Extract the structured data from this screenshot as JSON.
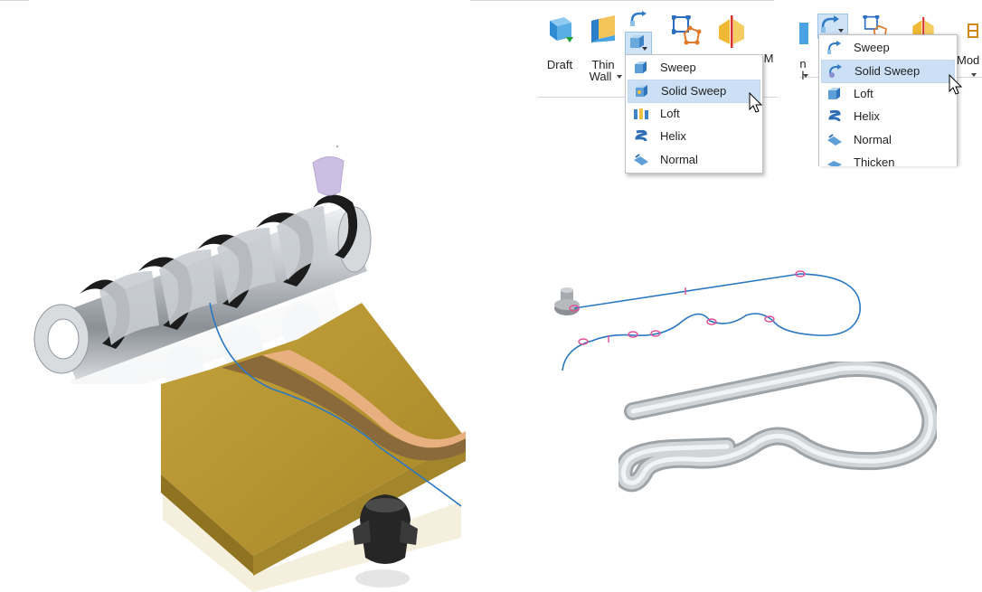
{
  "ribbon_left": {
    "draft_label": "Draft",
    "thin_wall_label": [
      "Thin",
      "Wall"
    ],
    "partial_label": "M",
    "menu_items": [
      {
        "label": "Sweep",
        "icon": "sweep-icon",
        "selected": false
      },
      {
        "label": "Solid Sweep",
        "icon": "solid-sweep-icon",
        "selected": true
      },
      {
        "label": "Loft",
        "icon": "loft-icon",
        "selected": false
      },
      {
        "label": "Helix",
        "icon": "helix-icon",
        "selected": false
      },
      {
        "label": "Normal",
        "icon": "normal-icon",
        "selected": false
      }
    ]
  },
  "ribbon_right": {
    "partial_left_label": [
      "n",
      "l"
    ],
    "partial_right_label": "Mod",
    "menu_items": [
      {
        "label": "Sweep",
        "icon": "sweep-icon",
        "selected": false
      },
      {
        "label": "Solid Sweep",
        "icon": "solid-sweep-icon",
        "selected": true
      },
      {
        "label": "Loft",
        "icon": "loft-icon",
        "selected": false
      },
      {
        "label": "Helix",
        "icon": "helix-icon",
        "selected": false
      },
      {
        "label": "Normal",
        "icon": "normal-icon",
        "selected": false
      },
      {
        "label": "Thicken",
        "icon": "thicken-icon",
        "selected": false
      }
    ]
  },
  "colors": {
    "selection": "#cce0f5",
    "curve_blue": "#2a77c4",
    "wood": "#b9952f",
    "copper": "#e7ad7c",
    "steel": "#b8bcc2"
  }
}
